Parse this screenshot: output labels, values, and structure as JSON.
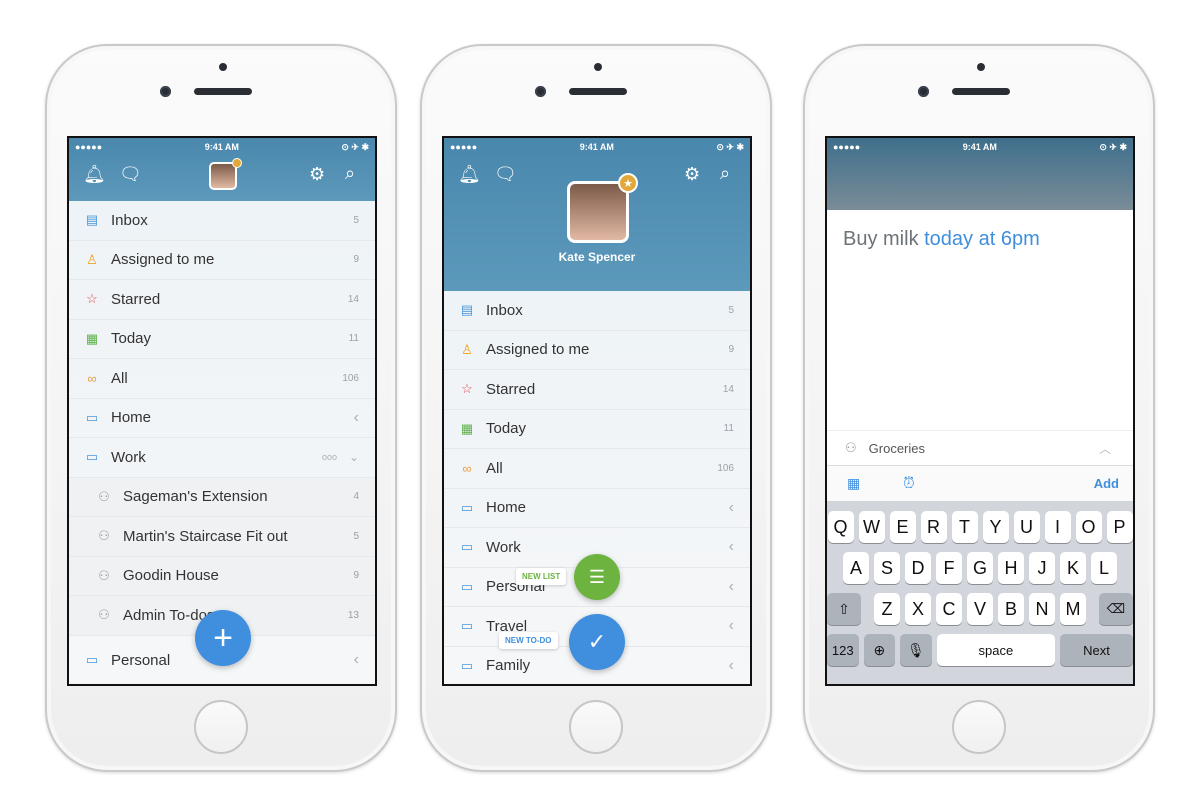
{
  "status": {
    "carrier": "●●●●● ",
    "time": "9:41 AM",
    "right": "⊙ ✈ ✱ "
  },
  "phone1": {
    "items": [
      {
        "icon": "inbox-icon",
        "glyph": "▤",
        "color": "#4a97d8",
        "label": "Inbox",
        "count": "5"
      },
      {
        "icon": "assigned-icon",
        "glyph": "♙",
        "color": "#f0a020",
        "label": "Assigned to me",
        "count": "9"
      },
      {
        "icon": "star-icon",
        "glyph": "☆",
        "color": "#e0454a",
        "label": "Starred",
        "count": "14"
      },
      {
        "icon": "calendar-icon",
        "glyph": "▦",
        "color": "#5db24a",
        "label": "Today",
        "count": "11"
      },
      {
        "icon": "infinity-icon",
        "glyph": "∞",
        "color": "#e3a24a",
        "label": "All",
        "count": "106"
      }
    ],
    "folders": {
      "home": "Home",
      "work": "Work",
      "personal": "Personal"
    },
    "work_more": "ooo",
    "sublists": [
      {
        "label": "Sageman's Extension",
        "count": "4"
      },
      {
        "label": "Martin's Staircase Fit out",
        "count": "5"
      },
      {
        "label": "Goodin House",
        "count": "9"
      },
      {
        "label": "Admin To-dos",
        "count": "13"
      }
    ],
    "fab": "+"
  },
  "phone2": {
    "user_name": "Kate Spencer",
    "items": [
      {
        "glyph": "▤",
        "color": "#4a97d8",
        "label": "Inbox",
        "count": "5"
      },
      {
        "glyph": "♙",
        "color": "#f0a020",
        "label": "Assigned to me",
        "count": "9"
      },
      {
        "glyph": "☆",
        "color": "#e0454a",
        "label": "Starred",
        "count": "14"
      },
      {
        "glyph": "▦",
        "color": "#5db24a",
        "label": "Today",
        "count": "11"
      },
      {
        "glyph": "∞",
        "color": "#e3a24a",
        "label": "All",
        "count": "106"
      }
    ],
    "folders": [
      "Home",
      "Work",
      "Personal",
      "Travel",
      "Family"
    ],
    "new_list": "NEW LIST",
    "new_todo": "NEW TO-DO",
    "fab_list": "☰",
    "fab_todo": "✓"
  },
  "phone3": {
    "task_text": "Buy milk ",
    "task_highlight": "today at 6pm",
    "list_name": "Groceries",
    "add_label": "Add",
    "keyboard": {
      "row1": [
        "Q",
        "W",
        "E",
        "R",
        "T",
        "Y",
        "U",
        "I",
        "O",
        "P"
      ],
      "row2": [
        "A",
        "S",
        "D",
        "F",
        "G",
        "H",
        "J",
        "K",
        "L"
      ],
      "row3": [
        "Z",
        "X",
        "C",
        "V",
        "B",
        "N",
        "M"
      ],
      "numbers": "123",
      "space": "space",
      "next": "Next"
    }
  },
  "colors": {
    "accent": "#4a90d9",
    "header": "#5290b5",
    "green": "#6db33f"
  }
}
